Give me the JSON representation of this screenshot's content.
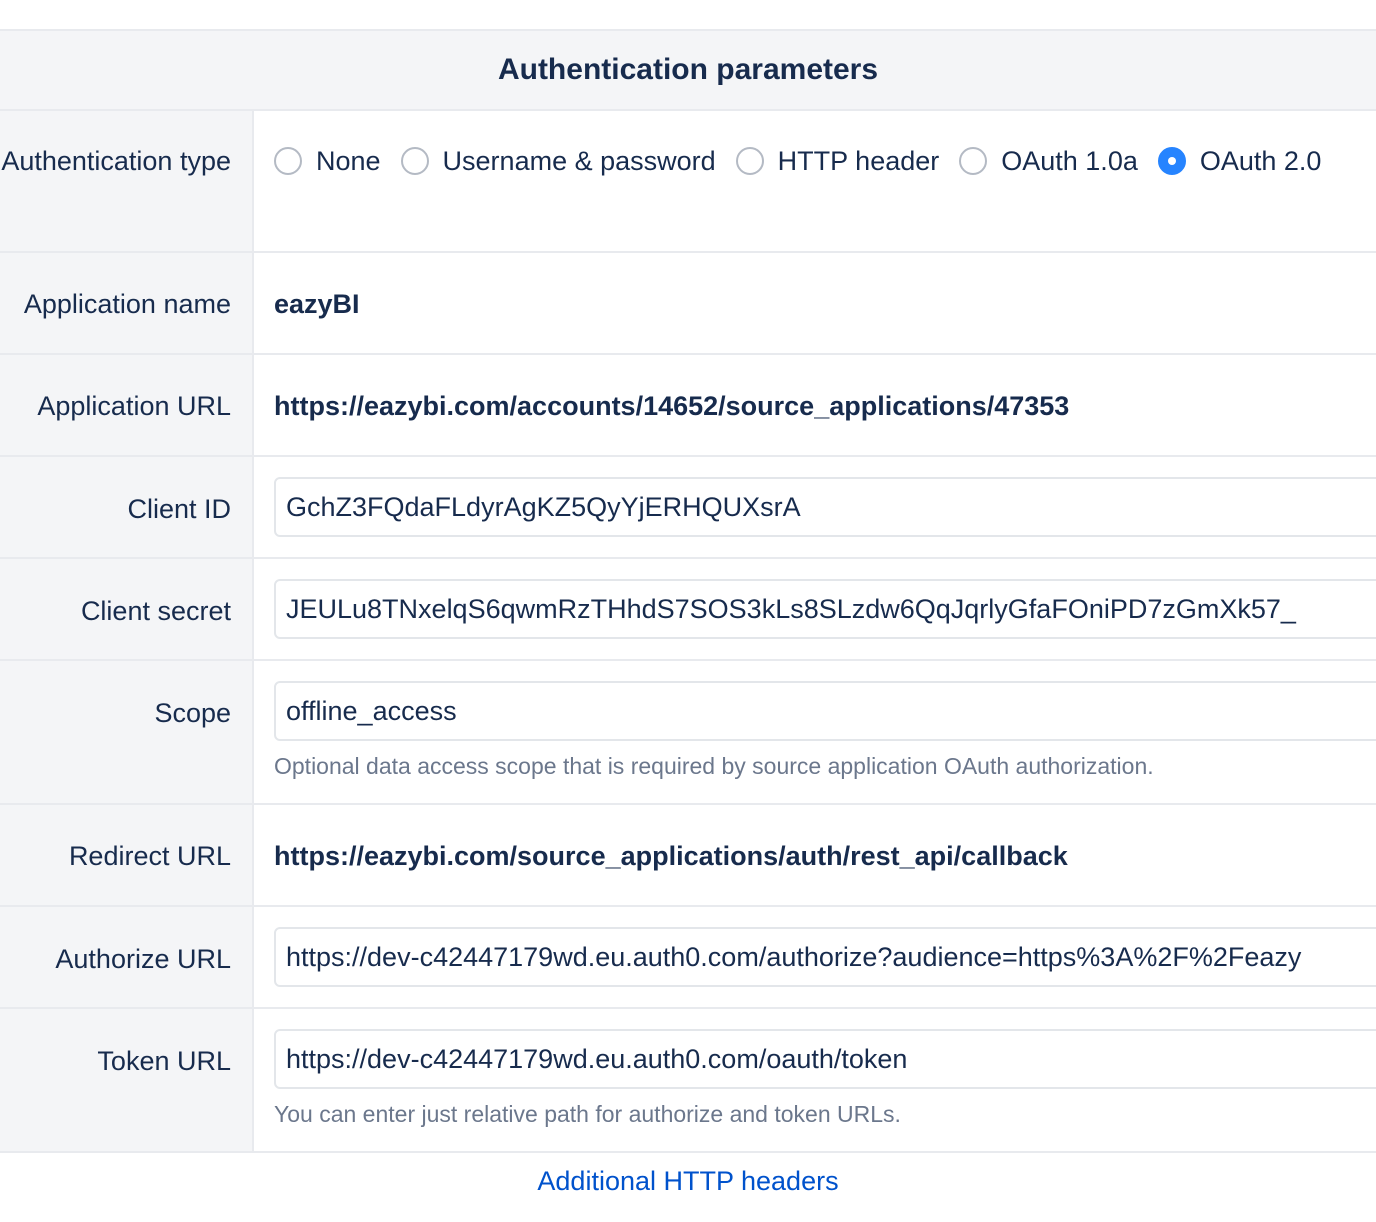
{
  "section": {
    "title": "Authentication parameters"
  },
  "auth_type": {
    "label": "Authentication type",
    "options": [
      {
        "label": "None",
        "checked": false
      },
      {
        "label": "Username & password",
        "checked": false
      },
      {
        "label": "HTTP header",
        "checked": false
      },
      {
        "label": "OAuth 1.0a",
        "checked": false
      },
      {
        "label": "OAuth 2.0",
        "checked": true
      }
    ]
  },
  "app_name": {
    "label": "Application name",
    "value": "eazyBI"
  },
  "app_url": {
    "label": "Application URL",
    "value": "https://eazybi.com/accounts/14652/source_applications/47353"
  },
  "client_id": {
    "label": "Client ID",
    "value": "GchZ3FQdaFLdyrAgKZ5QyYjERHQUXsrA"
  },
  "client_secret": {
    "label": "Client secret",
    "value": "JEULu8TNxelqS6qwmRzTHhdS7SOS3kLs8SLzdw6QqJqrlyGfaFOniPD7zGmXk57_"
  },
  "scope": {
    "label": "Scope",
    "value": "offline_access",
    "help": "Optional data access scope that is required by source application OAuth authorization."
  },
  "redirect_url": {
    "label": "Redirect URL",
    "value": "https://eazybi.com/source_applications/auth/rest_api/callback"
  },
  "authorize_url": {
    "label": "Authorize URL",
    "value": "https://dev-c42447179wd.eu.auth0.com/authorize?audience=https%3A%2F%2Feazy"
  },
  "token_url": {
    "label": "Token URL",
    "value": "https://dev-c42447179wd.eu.auth0.com/oauth/token",
    "help": "You can enter just relative path for authorize and token URLs."
  },
  "footer": {
    "link_label": "Additional HTTP headers"
  },
  "colors": {
    "radio_checked": "#2684ff",
    "link": "#0052cc",
    "text": "#172b4d",
    "help_text": "#6b778c",
    "label_background": "#f4f5f7"
  }
}
